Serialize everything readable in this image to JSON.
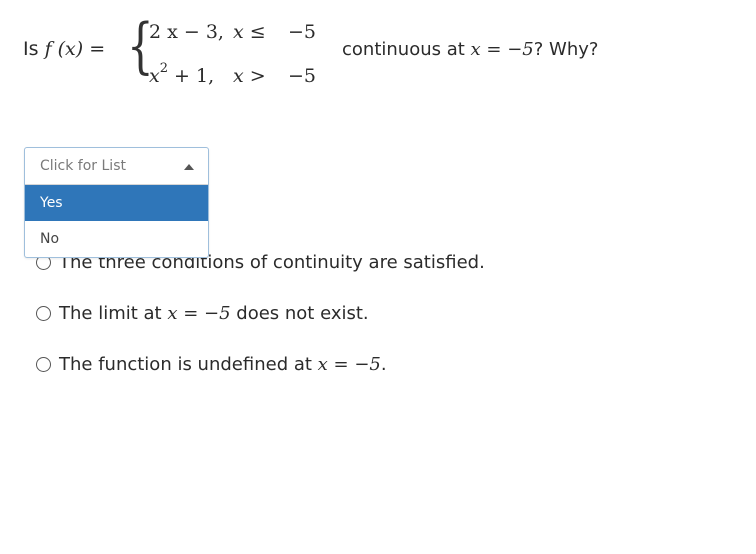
{
  "question": {
    "prefix_word": "Is",
    "function_lhs": "f (x) =",
    "piece1_expr": "2 x − 3,",
    "piece1_cond": "x ≤",
    "piece1_value": "−5",
    "piece2_base": "x",
    "piece2_exp": "2",
    "piece2_rest": " + 1,",
    "piece2_cond": "x >",
    "piece2_value": "−5",
    "suffix_text": "continuous at ",
    "suffix_math": "x = −5",
    "suffix_end": "? Why?"
  },
  "dropdown": {
    "placeholder": "Click for List",
    "options": [
      {
        "label": "Yes",
        "selected": true
      },
      {
        "label": "No",
        "selected": false
      }
    ]
  },
  "choices": [
    {
      "text": "The three conditions of continuity are satisfied."
    },
    {
      "pre": "The limit at ",
      "math": "x = −5",
      "post": " does not exist."
    },
    {
      "pre": "The function is undefined at ",
      "math": "x = −5",
      "post": "."
    }
  ],
  "colors": {
    "selected_bg": "#2f76b9",
    "selected_text": "#ffffff",
    "border_focus": "#9fbfdc"
  }
}
